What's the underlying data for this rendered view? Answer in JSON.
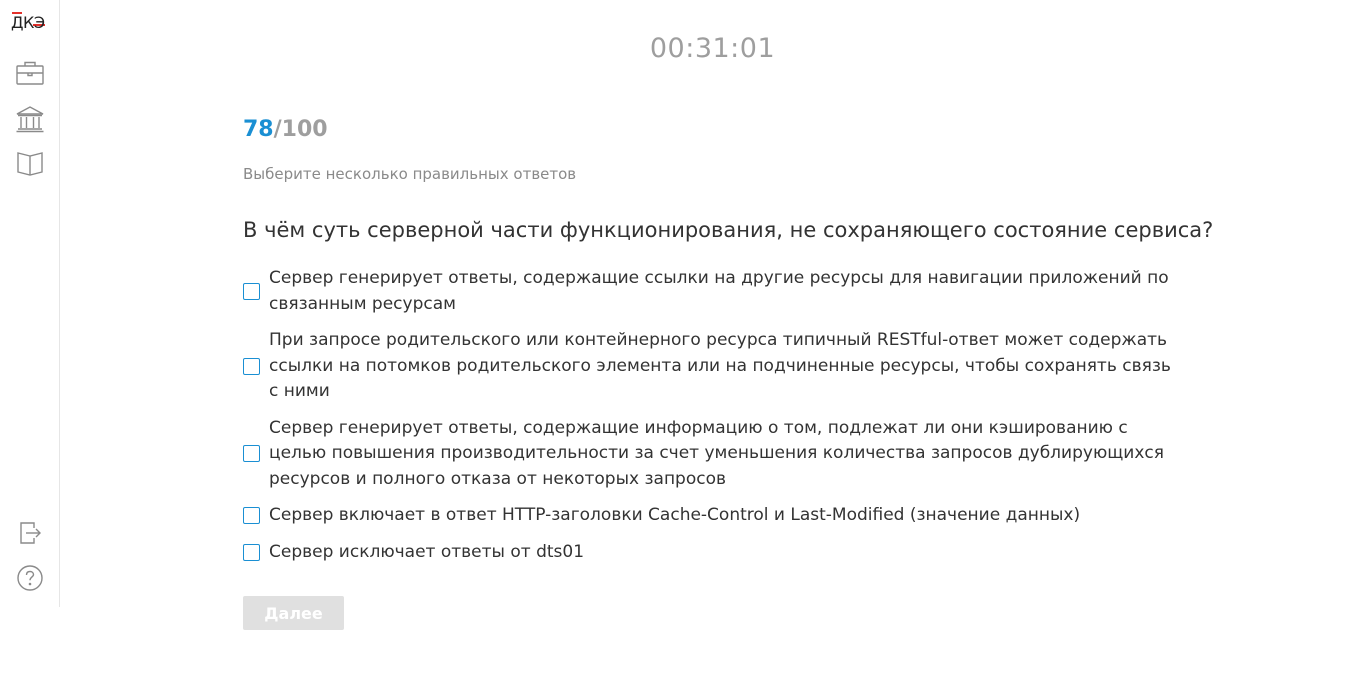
{
  "app": {
    "logo_text": "ДКЭ"
  },
  "sidebar": {
    "top_icons": [
      "briefcase-icon",
      "institution-icon",
      "book-icon"
    ],
    "bottom_icons": [
      "logout-icon",
      "help-icon"
    ]
  },
  "timer": "00:31:01",
  "progress": {
    "current": "78",
    "total": "/100"
  },
  "hint": "Выберите несколько правильных ответов",
  "question": "В чём суть серверной части функционирования, не сохраняющего состояние сервиса?",
  "options": [
    {
      "label": "Сервер генерирует ответы, содержащие ссылки на другие ресурсы для навигации приложений по связанным ресурсам",
      "checked": false
    },
    {
      "label": "При запросе родительского или контейнерного ресурса типичный RESTful-ответ может содержать ссылки на потомков родительского элемента или на подчиненные ресурсы, чтобы сохранять связь с ними",
      "checked": false
    },
    {
      "label": "Сервер генерирует ответы, содержащие информацию о том, подлежат ли они кэшированию с целью повышения производительности за счет уменьшения количества запросов дублирующихся ресурсов и полного отказа от некоторых запросов",
      "checked": false
    },
    {
      "label": "Сервер включает в ответ HTTP-заголовки Cache-Control и Last-Modified (значение данных)",
      "checked": false
    },
    {
      "label": "Сервер исключает ответы от dts01",
      "checked": false
    }
  ],
  "next_button": {
    "label": "Далее",
    "disabled": true
  },
  "colors": {
    "accent": "#1a8fd3",
    "logo_red": "#e4312b",
    "muted": "#9e9e9e",
    "button_disabled": "#e0e0e0"
  }
}
